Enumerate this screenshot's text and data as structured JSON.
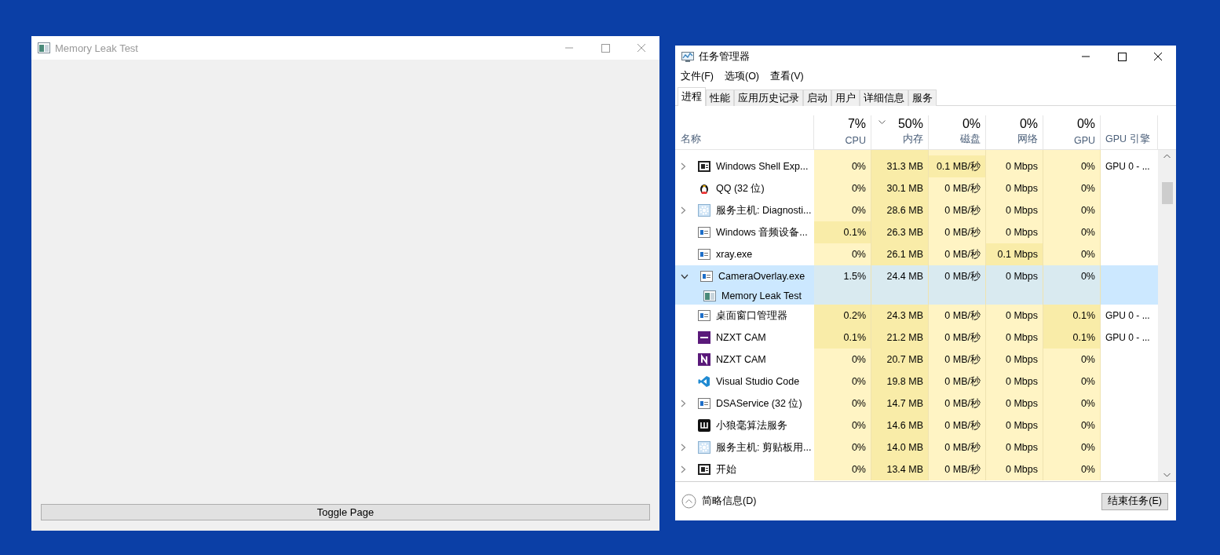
{
  "left_window": {
    "title": "Memory Leak Test",
    "button": "Toggle Page"
  },
  "task_manager": {
    "title": "任务管理器",
    "menu": [
      "文件(F)",
      "选项(O)",
      "查看(V)"
    ],
    "tabs": [
      {
        "label": "进程",
        "selected": true
      },
      {
        "label": "性能",
        "selected": false
      },
      {
        "label": "应用历史记录",
        "selected": false
      },
      {
        "label": "启动",
        "selected": false
      },
      {
        "label": "用户",
        "selected": false
      },
      {
        "label": "详细信息",
        "selected": false
      },
      {
        "label": "服务",
        "selected": false
      }
    ],
    "name_column": "名称",
    "columns": [
      {
        "percent": "7%",
        "label": "CPU",
        "sorted": false
      },
      {
        "percent": "50%",
        "label": "内存",
        "sorted": true
      },
      {
        "percent": "0%",
        "label": "磁盘",
        "sorted": false
      },
      {
        "percent": "0%",
        "label": "网络",
        "sorted": false
      },
      {
        "percent": "0%",
        "label": "GPU",
        "sorted": false
      }
    ],
    "engine_column": "GPU 引擎",
    "rows": [
      {
        "name": "Windows Shell Exp...",
        "kind": "shell",
        "expandable": true,
        "expanded": false,
        "selected": false,
        "cells": [
          {
            "text": "0%",
            "highlighted": false
          },
          {
            "text": "31.3 MB",
            "highlighted": true
          },
          {
            "text": "0.1 MB/秒",
            "highlighted": true
          },
          {
            "text": "0 Mbps",
            "highlighted": false
          },
          {
            "text": "0%",
            "highlighted": false
          }
        ],
        "engine": "GPU 0 - ..."
      },
      {
        "name": "QQ (32 位)",
        "kind": "penguin",
        "expandable": false,
        "selected": false,
        "cells": [
          {
            "text": "0%",
            "highlighted": false
          },
          {
            "text": "30.1 MB",
            "highlighted": true
          },
          {
            "text": "0 MB/秒",
            "highlighted": false
          },
          {
            "text": "0 Mbps",
            "highlighted": false
          },
          {
            "text": "0%",
            "highlighted": false
          }
        ]
      },
      {
        "name": "服务主机: Diagnosti...",
        "kind": "gear",
        "expandable": true,
        "expanded": false,
        "selected": false,
        "cells": [
          {
            "text": "0%",
            "highlighted": false
          },
          {
            "text": "28.6 MB",
            "highlighted": true
          },
          {
            "text": "0 MB/秒",
            "highlighted": false
          },
          {
            "text": "0 Mbps",
            "highlighted": false
          },
          {
            "text": "0%",
            "highlighted": false
          }
        ]
      },
      {
        "name": "Windows 音频设备...",
        "kind": "window",
        "expandable": false,
        "selected": false,
        "cells": [
          {
            "text": "0.1%",
            "highlighted": true
          },
          {
            "text": "26.3 MB",
            "highlighted": true
          },
          {
            "text": "0 MB/秒",
            "highlighted": false
          },
          {
            "text": "0 Mbps",
            "highlighted": false
          },
          {
            "text": "0%",
            "highlighted": false
          }
        ]
      },
      {
        "name": "xray.exe",
        "kind": "window",
        "expandable": false,
        "selected": false,
        "cells": [
          {
            "text": "0%",
            "highlighted": false
          },
          {
            "text": "26.1 MB",
            "highlighted": true
          },
          {
            "text": "0 MB/秒",
            "highlighted": false
          },
          {
            "text": "0.1 Mbps",
            "highlighted": true
          },
          {
            "text": "0%",
            "highlighted": false
          }
        ]
      },
      {
        "name": "CameraOverlay.exe",
        "kind": "window",
        "expandable": true,
        "expanded": true,
        "selected": true,
        "cells": [
          {
            "text": "1.5%"
          },
          {
            "text": "24.4 MB"
          },
          {
            "text": "0 MB/秒"
          },
          {
            "text": "0 Mbps"
          },
          {
            "text": "0%"
          }
        ],
        "children": [
          {
            "name": "Memory Leak Test"
          }
        ]
      },
      {
        "name": "桌面窗口管理器",
        "kind": "window",
        "expandable": false,
        "selected": false,
        "cells": [
          {
            "text": "0.2%",
            "highlighted": true
          },
          {
            "text": "24.3 MB",
            "highlighted": true
          },
          {
            "text": "0 MB/秒",
            "highlighted": false
          },
          {
            "text": "0 Mbps",
            "highlighted": false
          },
          {
            "text": "0.1%",
            "highlighted": true
          }
        ],
        "engine": "GPU 0 - ..."
      },
      {
        "name": "NZXT CAM",
        "kind": "wide-tile",
        "expandable": false,
        "selected": false,
        "cells": [
          {
            "text": "0.1%",
            "highlighted": true
          },
          {
            "text": "21.2 MB",
            "highlighted": true
          },
          {
            "text": "0 MB/秒",
            "highlighted": false
          },
          {
            "text": "0 Mbps",
            "highlighted": false
          },
          {
            "text": "0.1%",
            "highlighted": true
          }
        ],
        "engine": "GPU 0 - ..."
      },
      {
        "name": "NZXT CAM",
        "kind": "letter-tile",
        "expandable": false,
        "selected": false,
        "cells": [
          {
            "text": "0%",
            "highlighted": false
          },
          {
            "text": "20.7 MB",
            "highlighted": true
          },
          {
            "text": "0 MB/秒",
            "highlighted": false
          },
          {
            "text": "0 Mbps",
            "highlighted": false
          },
          {
            "text": "0%",
            "highlighted": false
          }
        ]
      },
      {
        "name": "Visual Studio Code",
        "kind": "ribbon",
        "expandable": false,
        "selected": false,
        "cells": [
          {
            "text": "0%",
            "highlighted": false
          },
          {
            "text": "19.8 MB",
            "highlighted": true
          },
          {
            "text": "0 MB/秒",
            "highlighted": false
          },
          {
            "text": "0 Mbps",
            "highlighted": false
          },
          {
            "text": "0%",
            "highlighted": false
          }
        ]
      },
      {
        "name": "DSAService (32 位)",
        "kind": "window",
        "expandable": true,
        "expanded": false,
        "selected": false,
        "cells": [
          {
            "text": "0%",
            "highlighted": false
          },
          {
            "text": "14.7 MB",
            "highlighted": true
          },
          {
            "text": "0 MB/秒",
            "highlighted": false
          },
          {
            "text": "0 Mbps",
            "highlighted": false
          },
          {
            "text": "0%",
            "highlighted": false
          }
        ]
      },
      {
        "name": "小狼毫算法服务",
        "kind": "black-tile",
        "expandable": false,
        "selected": false,
        "cells": [
          {
            "text": "0%",
            "highlighted": false
          },
          {
            "text": "14.6 MB",
            "highlighted": true
          },
          {
            "text": "0 MB/秒",
            "highlighted": false
          },
          {
            "text": "0 Mbps",
            "highlighted": false
          },
          {
            "text": "0%",
            "highlighted": false
          }
        ]
      },
      {
        "name": "服务主机: 剪贴板用...",
        "kind": "gear",
        "expandable": true,
        "expanded": false,
        "selected": false,
        "cells": [
          {
            "text": "0%",
            "highlighted": false
          },
          {
            "text": "14.0 MB",
            "highlighted": true
          },
          {
            "text": "0 MB/秒",
            "highlighted": false
          },
          {
            "text": "0 Mbps",
            "highlighted": false
          },
          {
            "text": "0%",
            "highlighted": false
          }
        ]
      },
      {
        "name": "开始",
        "kind": "shell",
        "expandable": true,
        "expanded": false,
        "selected": false,
        "cells": [
          {
            "text": "0%",
            "highlighted": false
          },
          {
            "text": "13.4 MB",
            "highlighted": true
          },
          {
            "text": "0 MB/秒",
            "highlighted": false
          },
          {
            "text": "0 Mbps",
            "highlighted": false
          },
          {
            "text": "0%",
            "highlighted": false
          }
        ]
      }
    ],
    "brief": "简略信息(D)",
    "end_task": "结束任务(E)"
  }
}
